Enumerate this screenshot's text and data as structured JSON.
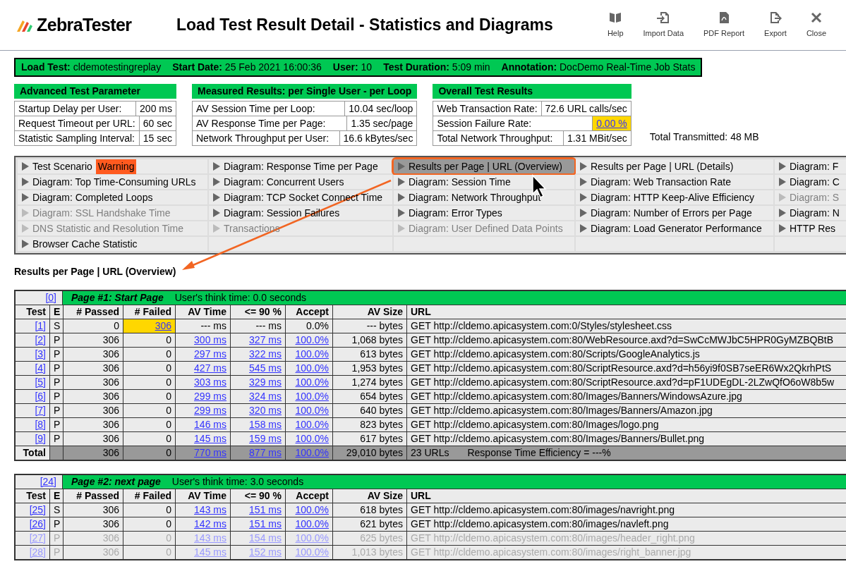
{
  "header": {
    "logo": "ZebraTester",
    "title": "Load Test Result Detail - Statistics and Diagrams",
    "toolbar": [
      {
        "label": "Help"
      },
      {
        "label": "Import Data"
      },
      {
        "label": "PDF Report"
      },
      {
        "label": "Export"
      },
      {
        "label": "Close"
      }
    ]
  },
  "summary": [
    {
      "label": "Load Test:",
      "value": "cldemotestingreplay"
    },
    {
      "label": "Start Date:",
      "value": "25 Feb 2021 16:00:36"
    },
    {
      "label": "User:",
      "value": "10"
    },
    {
      "label": "Test Duration:",
      "value": "5:09 min"
    },
    {
      "label": "Annotation:",
      "value": "DocDemo Real-Time Job Stats"
    }
  ],
  "panels": [
    {
      "title": "Advanced Test Parameter",
      "rows": [
        {
          "label": "Startup Delay per User:",
          "value": "200 ms",
          "highlighted": false
        },
        {
          "label": "Request Timeout per URL:",
          "value": "60 sec",
          "highlighted": false
        },
        {
          "label": "Statistic Sampling Interval:",
          "value": "15 sec",
          "highlighted": false
        }
      ]
    },
    {
      "title": "Measured Results: per Single User - per Loop",
      "rows": [
        {
          "label": "AV Session Time per Loop:",
          "value": "10.04 sec/loop",
          "highlighted": false
        },
        {
          "label": "AV Response Time per Page:",
          "value": "1.35 sec/page",
          "highlighted": false
        },
        {
          "label": "Network Throughput per User:",
          "value": "16.6 kBytes/sec",
          "highlighted": false
        }
      ]
    },
    {
      "title": "Overall Test Results",
      "rows": [
        {
          "label": "Web Transaction Rate:",
          "value": "72.6 URL calls/sec",
          "highlighted": false
        },
        {
          "label": "Session Failure Rate:",
          "value": "0.00 %",
          "highlighted": true
        },
        {
          "label": "Total Network Throughput:",
          "value": "1.31 MBit/sec",
          "highlighted": false
        }
      ]
    }
  ],
  "total_transmitted": "Total Transmitted: 48 MB",
  "nav": [
    [
      {
        "label": "Test Scenario",
        "badge": "Warning",
        "enabled": true,
        "selected": false
      },
      {
        "label": "Diagram: Response Time per Page",
        "enabled": true,
        "selected": false
      },
      {
        "label": "Results per Page | URL (Overview)",
        "enabled": true,
        "selected": true
      },
      {
        "label": "Results per Page | URL (Details)",
        "enabled": true,
        "selected": false
      },
      {
        "label": "Diagram: F",
        "enabled": true,
        "selected": false
      }
    ],
    [
      {
        "label": "Diagram: Top Time-Consuming URLs",
        "enabled": true,
        "selected": false
      },
      {
        "label": "Diagram: Concurrent Users",
        "enabled": true,
        "selected": false
      },
      {
        "label": "Diagram: Session Time",
        "enabled": true,
        "selected": false
      },
      {
        "label": "Diagram: Web Transaction Rate",
        "enabled": true,
        "selected": false
      },
      {
        "label": "Diagram: C",
        "enabled": true,
        "selected": false
      }
    ],
    [
      {
        "label": "Diagram: Completed Loops",
        "enabled": true,
        "selected": false
      },
      {
        "label": "Diagram: TCP Socket Connect Time",
        "enabled": true,
        "selected": false
      },
      {
        "label": "Diagram: Network Throughput",
        "enabled": true,
        "selected": false
      },
      {
        "label": "Diagram: HTTP Keep-Alive Efficiency",
        "enabled": true,
        "selected": false
      },
      {
        "label": "Diagram: S",
        "enabled": false,
        "selected": false
      }
    ],
    [
      {
        "label": "Diagram: SSL Handshake Time",
        "enabled": false,
        "selected": false
      },
      {
        "label": "Diagram: Session Failures",
        "enabled": true,
        "selected": false
      },
      {
        "label": "Diagram: Error Types",
        "enabled": true,
        "selected": false
      },
      {
        "label": "Diagram: Number of Errors per Page",
        "enabled": true,
        "selected": false
      },
      {
        "label": "Diagram: N",
        "enabled": true,
        "selected": false
      }
    ],
    [
      {
        "label": "DNS Statistic and Resolution Time",
        "enabled": false,
        "selected": false
      },
      {
        "label": "Transactions",
        "enabled": false,
        "selected": false
      },
      {
        "label": "Diagram: User Defined Data Points",
        "enabled": false,
        "selected": false
      },
      {
        "label": "Diagram: Load Generator Performance",
        "enabled": true,
        "selected": false
      },
      {
        "label": "HTTP Res",
        "enabled": true,
        "selected": false
      }
    ],
    [
      {
        "label": "Browser Cache Statistic",
        "enabled": true,
        "selected": false
      }
    ]
  ],
  "section_title": "Results per Page | URL (Overview)",
  "pages": [
    {
      "index": "[0]",
      "title": "Page #1: Start Page",
      "think_time": "User's think time: 0.0 seconds",
      "columns": [
        "Test",
        "E",
        "# Passed",
        "# Failed",
        "AV Time",
        "<= 90 %",
        "Accept",
        "AV Size",
        "URL"
      ],
      "rows": [
        {
          "test": "[1]",
          "e": "S",
          "passed": "0",
          "failed": "306",
          "failed_highlight": true,
          "av_time": "--- ms",
          "p90": "--- ms",
          "accept": "0.0%",
          "timing_links": false,
          "size": "--- bytes",
          "url": "GET http://cldemo.apicasystem.com:0/Styles/stylesheet.css",
          "faded": false
        },
        {
          "test": "[2]",
          "e": "P",
          "passed": "306",
          "failed": "0",
          "failed_highlight": false,
          "av_time": "300 ms",
          "p90": "327 ms",
          "accept": "100.0%",
          "timing_links": true,
          "size": "1,068 bytes",
          "url": "GET http://cldemo.apicasystem.com:80/WebResource.axd?d=SwCcMWJbC5HPR0GyMZBQBtB",
          "faded": false
        },
        {
          "test": "[3]",
          "e": "P",
          "passed": "306",
          "failed": "0",
          "failed_highlight": false,
          "av_time": "297 ms",
          "p90": "322 ms",
          "accept": "100.0%",
          "timing_links": true,
          "size": "613 bytes",
          "url": "GET http://cldemo.apicasystem.com:80/Scripts/GoogleAnalytics.js",
          "faded": false
        },
        {
          "test": "[4]",
          "e": "P",
          "passed": "306",
          "failed": "0",
          "failed_highlight": false,
          "av_time": "427 ms",
          "p90": "545 ms",
          "accept": "100.0%",
          "timing_links": true,
          "size": "1,953 bytes",
          "url": "GET http://cldemo.apicasystem.com:80/ScriptResource.axd?d=h56yi9f0SB7seER6Wx2QkrhPtS",
          "faded": false
        },
        {
          "test": "[5]",
          "e": "P",
          "passed": "306",
          "failed": "0",
          "failed_highlight": false,
          "av_time": "303 ms",
          "p90": "329 ms",
          "accept": "100.0%",
          "timing_links": true,
          "size": "1,274 bytes",
          "url": "GET http://cldemo.apicasystem.com:80/ScriptResource.axd?d=pF1UDEgDL-2LZwQfO6oW8b5w",
          "faded": false
        },
        {
          "test": "[6]",
          "e": "P",
          "passed": "306",
          "failed": "0",
          "failed_highlight": false,
          "av_time": "299 ms",
          "p90": "324 ms",
          "accept": "100.0%",
          "timing_links": true,
          "size": "654 bytes",
          "url": "GET http://cldemo.apicasystem.com:80/Images/Banners/WindowsAzure.jpg",
          "faded": false
        },
        {
          "test": "[7]",
          "e": "P",
          "passed": "306",
          "failed": "0",
          "failed_highlight": false,
          "av_time": "299 ms",
          "p90": "320 ms",
          "accept": "100.0%",
          "timing_links": true,
          "size": "640 bytes",
          "url": "GET http://cldemo.apicasystem.com:80/Images/Banners/Amazon.jpg",
          "faded": false
        },
        {
          "test": "[8]",
          "e": "P",
          "passed": "306",
          "failed": "0",
          "failed_highlight": false,
          "av_time": "146 ms",
          "p90": "158 ms",
          "accept": "100.0%",
          "timing_links": true,
          "size": "823 bytes",
          "url": "GET http://cldemo.apicasystem.com:80/Images/logo.png",
          "faded": false
        },
        {
          "test": "[9]",
          "e": "P",
          "passed": "306",
          "failed": "0",
          "failed_highlight": false,
          "av_time": "145 ms",
          "p90": "159 ms",
          "accept": "100.0%",
          "timing_links": true,
          "size": "617 bytes",
          "url": "GET http://cldemo.apicasystem.com:80/Images/Banners/Bullet.png",
          "faded": false
        }
      ],
      "total": {
        "label": "Total",
        "passed": "306",
        "failed": "0",
        "av_time": "770 ms",
        "p90": "877 ms",
        "accept": "100.0%",
        "size": "29,010 bytes",
        "urls": "23 URLs",
        "efficiency": "Response Time Efficiency = ---%"
      }
    },
    {
      "index": "[24]",
      "title": "Page #2: next page",
      "think_time": "User's think time: 3.0 seconds",
      "columns": [
        "Test",
        "E",
        "# Passed",
        "# Failed",
        "AV Time",
        "<= 90 %",
        "Accept",
        "AV Size",
        "URL"
      ],
      "rows": [
        {
          "test": "[25]",
          "e": "S",
          "passed": "306",
          "failed": "0",
          "failed_highlight": false,
          "av_time": "143 ms",
          "p90": "151 ms",
          "accept": "100.0%",
          "timing_links": true,
          "size": "618 bytes",
          "url": "GET http://cldemo.apicasystem.com:80/images/navright.png",
          "faded": false
        },
        {
          "test": "[26]",
          "e": "P",
          "passed": "306",
          "failed": "0",
          "failed_highlight": false,
          "av_time": "142 ms",
          "p90": "151 ms",
          "accept": "100.0%",
          "timing_links": true,
          "size": "621 bytes",
          "url": "GET http://cldemo.apicasystem.com:80/images/navleft.png",
          "faded": false
        },
        {
          "test": "[27]",
          "e": "P",
          "passed": "306",
          "failed": "0",
          "failed_highlight": false,
          "av_time": "143 ms",
          "p90": "154 ms",
          "accept": "100.0%",
          "timing_links": true,
          "size": "625 bytes",
          "url": "GET http://cldemo.apicasystem.com:80/images/header_right.png",
          "faded": true
        },
        {
          "test": "[28]",
          "e": "P",
          "passed": "306",
          "failed": "0",
          "failed_highlight": false,
          "av_time": "145 ms",
          "p90": "152 ms",
          "accept": "100.0%",
          "timing_links": true,
          "size": "1,013 bytes",
          "url": "GET http://cldemo.apicasystem.com:80/images/right_banner.jpg",
          "faded": true
        }
      ]
    }
  ]
}
